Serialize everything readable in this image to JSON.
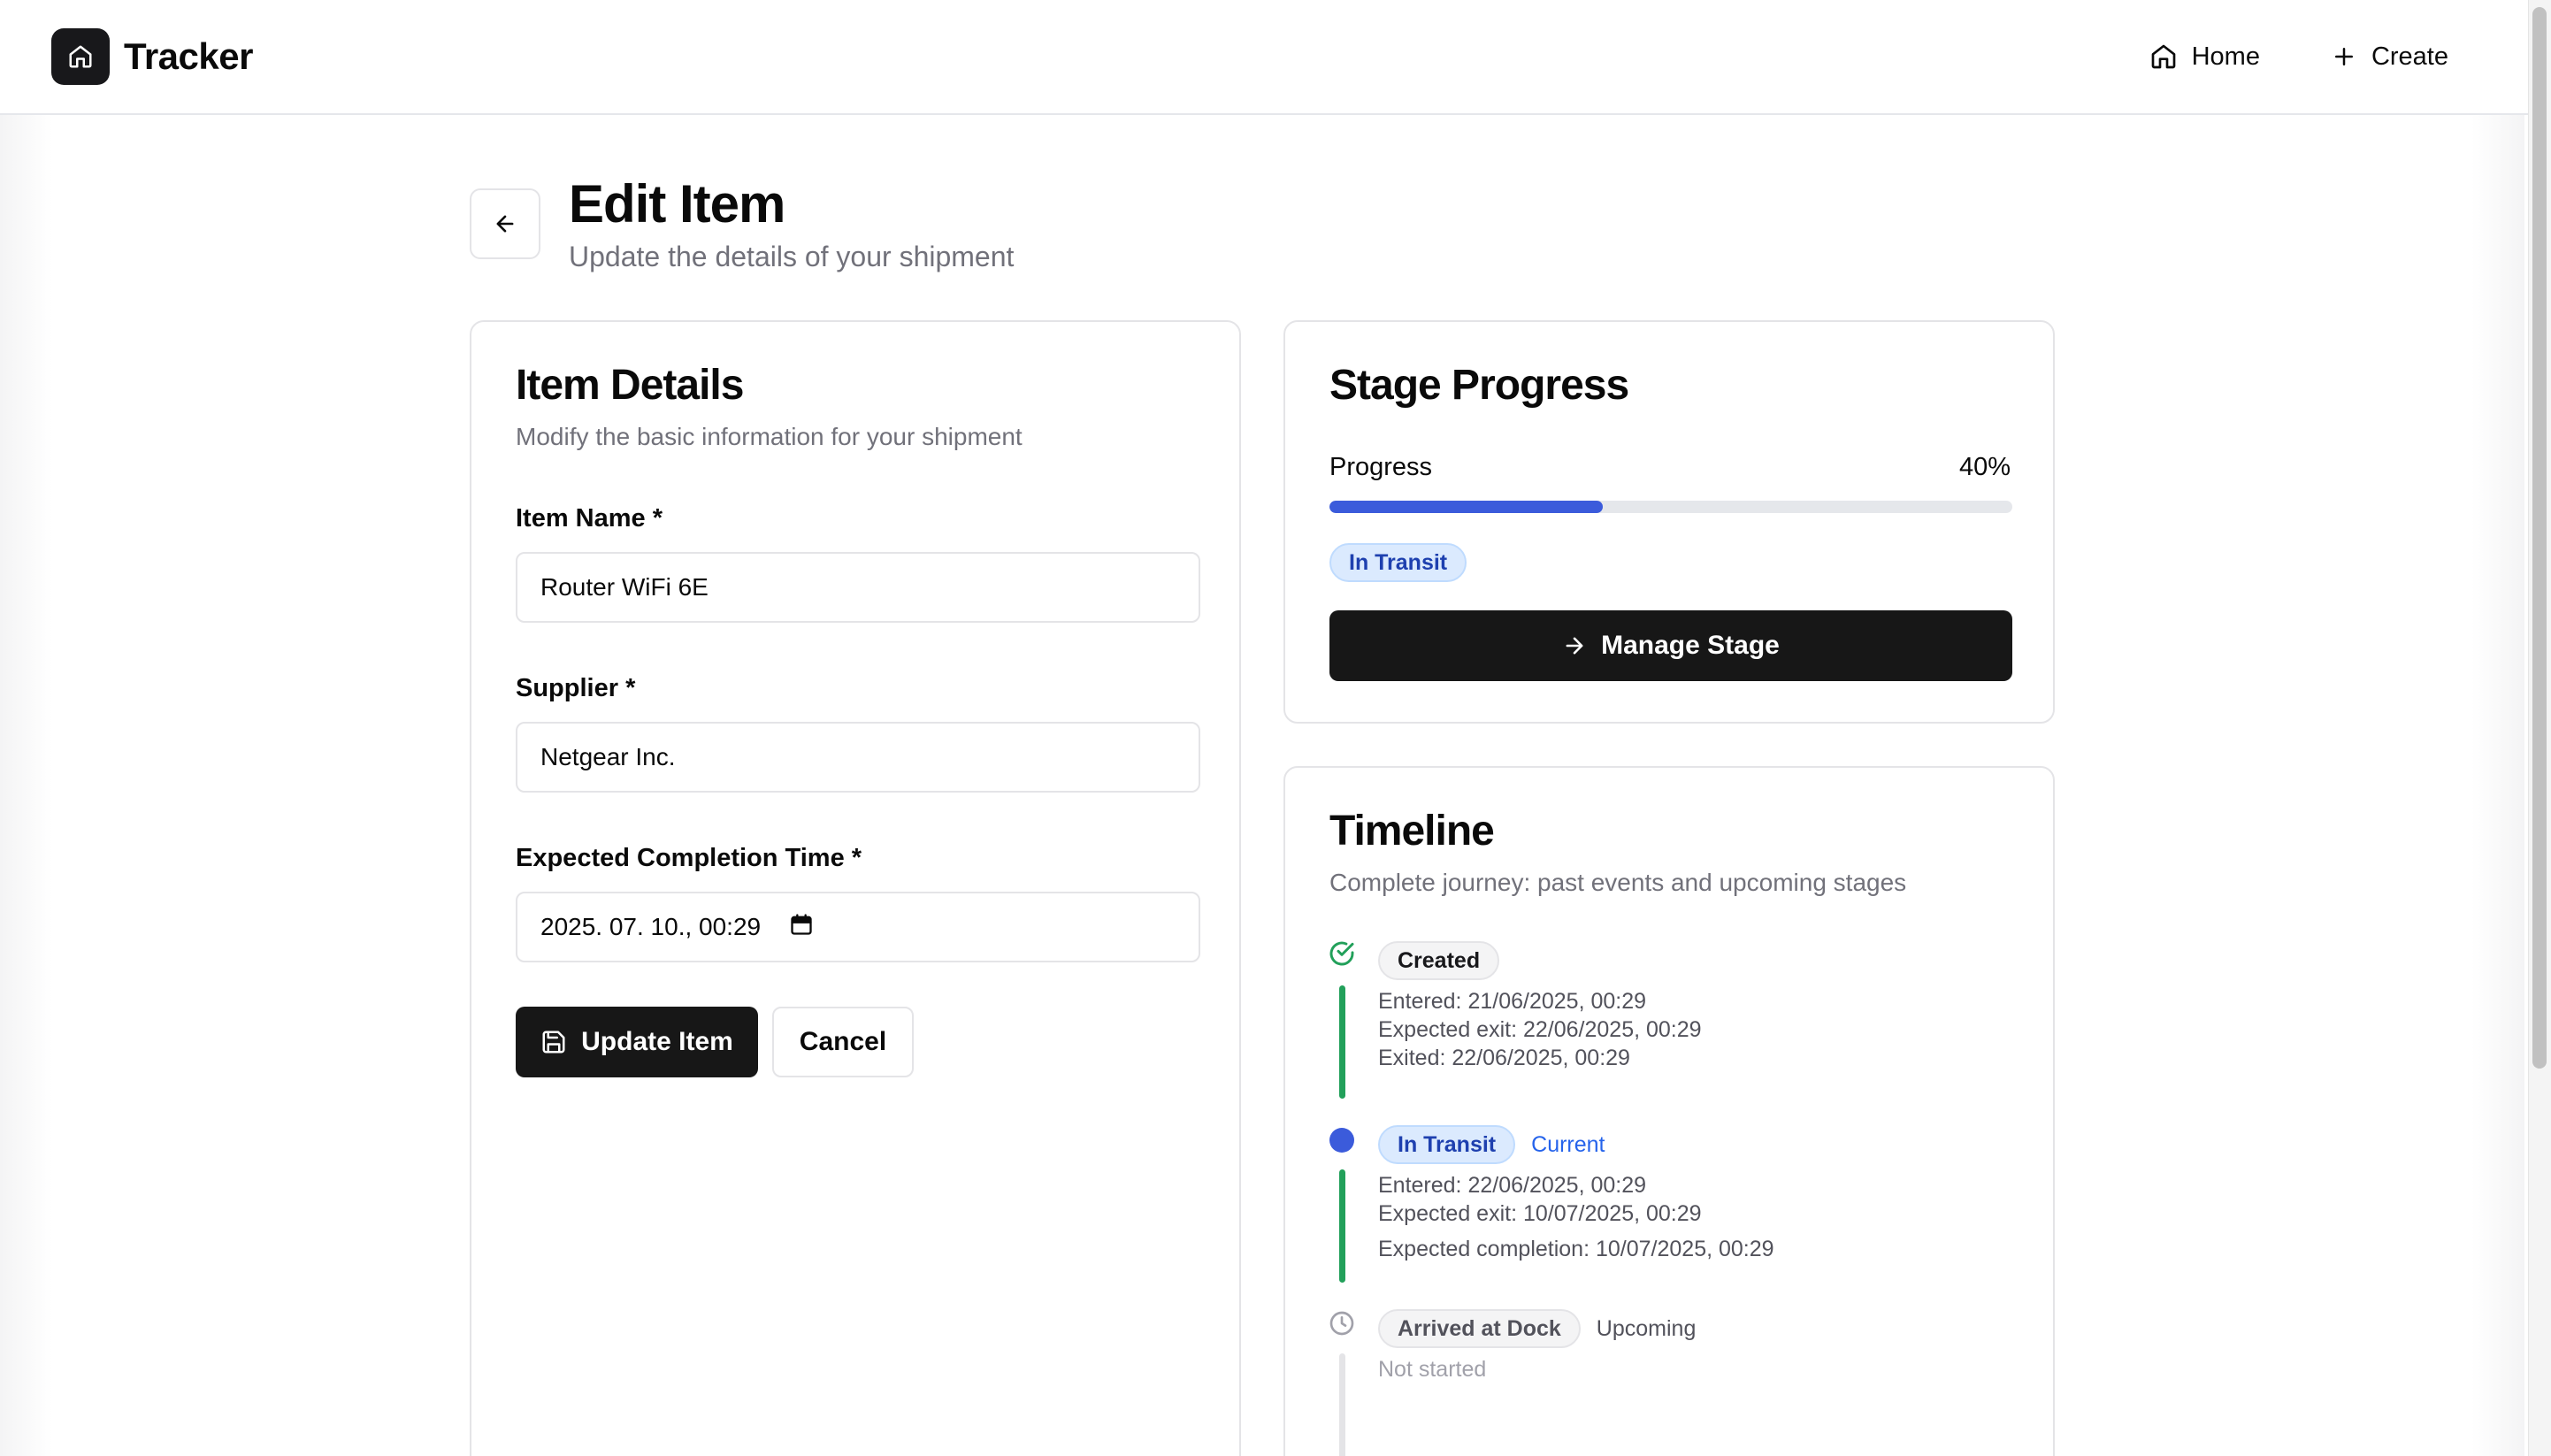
{
  "header": {
    "brand": "Tracker",
    "nav": {
      "home": "Home",
      "create": "Create"
    }
  },
  "page": {
    "title": "Edit Item",
    "subtitle": "Update the details of your shipment"
  },
  "details_card": {
    "title": "Item Details",
    "description": "Modify the basic information for your shipment",
    "fields": {
      "item_name": {
        "label": "Item Name *",
        "value": "Router WiFi 6E"
      },
      "supplier": {
        "label": "Supplier *",
        "value": "Netgear Inc."
      },
      "completion": {
        "label": "Expected Completion Time *",
        "value": "2025. 07. 10., 00:29"
      }
    },
    "update_label": "Update Item",
    "cancel_label": "Cancel"
  },
  "progress_card": {
    "title": "Stage Progress",
    "progress_label": "Progress",
    "progress_text": "40%",
    "progress_value": 0.4,
    "status_badge": "In Transit",
    "manage_label": "Manage Stage"
  },
  "timeline_card": {
    "title": "Timeline",
    "description": "Complete journey: past events and upcoming stages",
    "stages": [
      {
        "name": "Created",
        "lines": [
          "Entered: 21/06/2025, 00:29",
          "Expected exit: 22/06/2025, 00:29",
          "Exited: 22/06/2025, 00:29"
        ]
      },
      {
        "name": "In Transit",
        "tag": "Current",
        "lines": [
          "Entered: 22/06/2025, 00:29",
          "Expected exit: 10/07/2025, 00:29",
          "Expected completion: 10/07/2025, 00:29"
        ]
      },
      {
        "name": "Arrived at Dock",
        "tag": "Upcoming",
        "lines": [
          "Not started"
        ]
      }
    ]
  },
  "colors": {
    "primary": "#171717",
    "accent_blue": "#3b5bdb",
    "success_green": "#22a05a",
    "muted_text": "#71717a"
  }
}
